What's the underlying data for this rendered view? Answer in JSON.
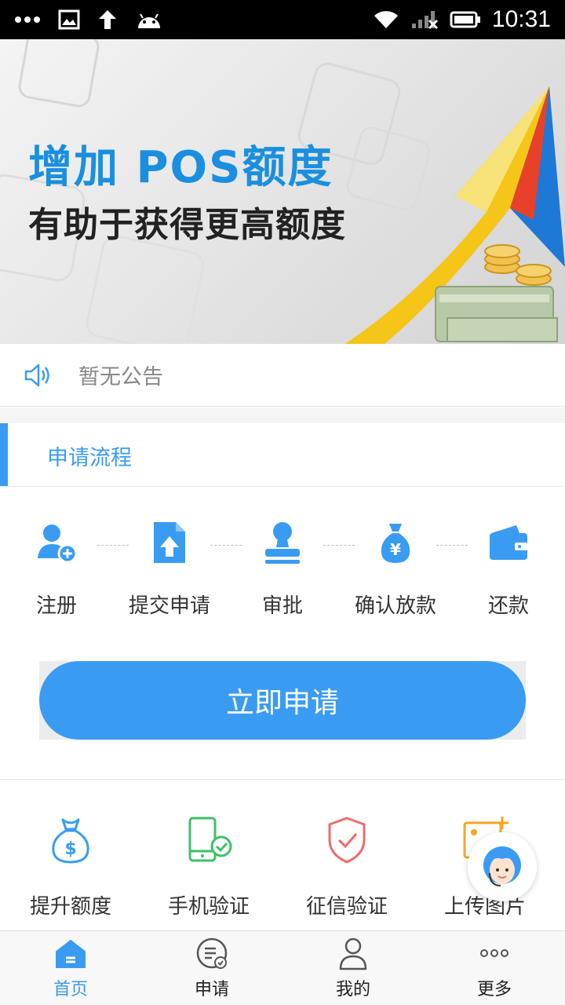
{
  "status_bar": {
    "time": "10:31"
  },
  "banner": {
    "line1": "增加 POS额度",
    "line2": "有助于获得更高额度"
  },
  "notice": {
    "text": "暂无公告"
  },
  "section": {
    "title": "申请流程"
  },
  "steps": [
    {
      "label": "注册",
      "icon": "user-add-icon"
    },
    {
      "label": "提交申请",
      "icon": "file-upload-icon"
    },
    {
      "label": "审批",
      "icon": "stamp-icon"
    },
    {
      "label": "确认放款",
      "icon": "money-bag-icon"
    },
    {
      "label": "还款",
      "icon": "wallet-icon"
    }
  ],
  "apply_button": {
    "label": "立即申请"
  },
  "features": [
    {
      "label": "提升额度",
      "icon": "money-bag-icon"
    },
    {
      "label": "手机验证",
      "icon": "phone-verify-icon"
    },
    {
      "label": "征信验证",
      "icon": "shield-check-icon"
    },
    {
      "label": "上传图片",
      "icon": "image-upload-icon"
    }
  ],
  "bottom_nav": [
    {
      "label": "首页",
      "icon": "home-icon",
      "active": true
    },
    {
      "label": "申请",
      "icon": "apply-list-icon",
      "active": false
    },
    {
      "label": "我的",
      "icon": "user-icon",
      "active": false
    },
    {
      "label": "更多",
      "icon": "more-icon",
      "active": false
    }
  ],
  "colors": {
    "accent": "#3a9bf2",
    "banner_blue": "#1a8fe0",
    "red_icon": "#f06b6b",
    "orange_icon": "#f5a623"
  }
}
